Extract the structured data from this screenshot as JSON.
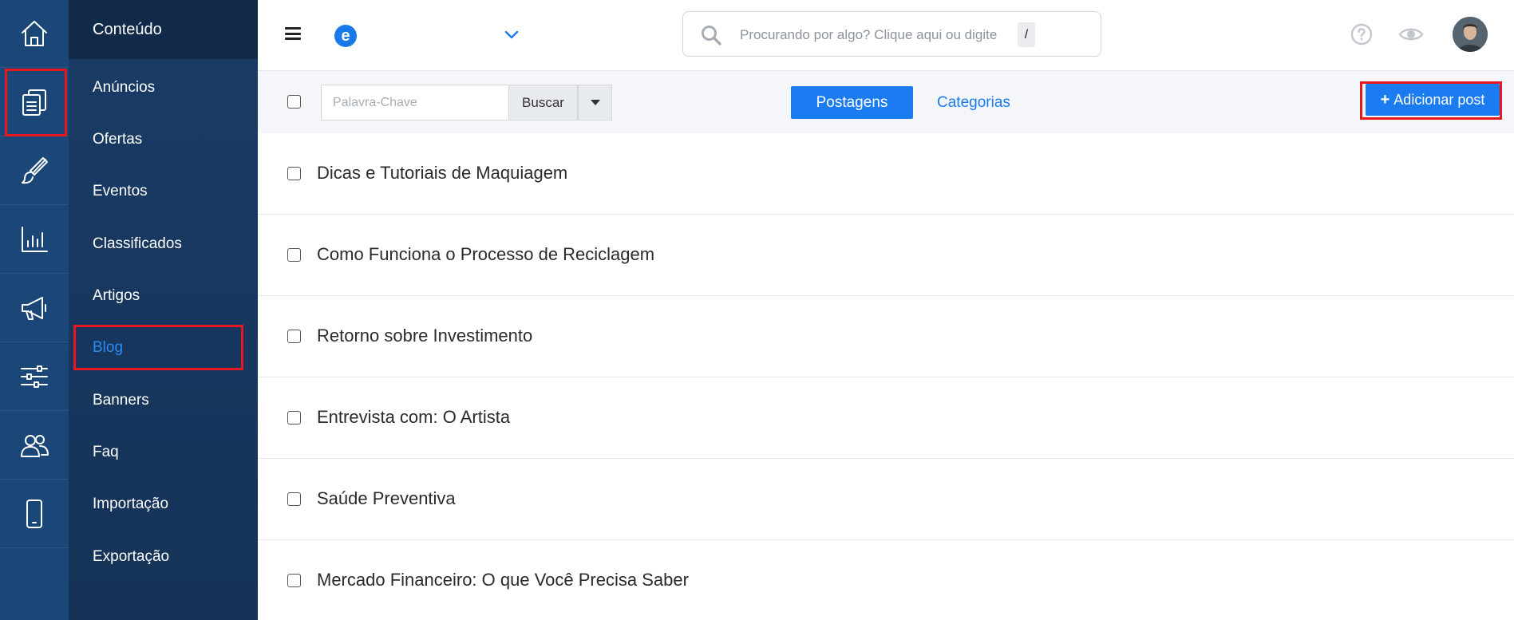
{
  "rail": {
    "items": [
      {
        "icon": "home-icon"
      },
      {
        "icon": "content-icon"
      },
      {
        "icon": "brush-icon"
      },
      {
        "icon": "chart-icon"
      },
      {
        "icon": "megaphone-icon"
      },
      {
        "icon": "sliders-icon"
      },
      {
        "icon": "users-icon"
      },
      {
        "icon": "mobile-icon"
      }
    ]
  },
  "sidebar": {
    "title": "Conteúdo",
    "items": [
      {
        "label": "Anúncios"
      },
      {
        "label": "Ofertas"
      },
      {
        "label": "Eventos"
      },
      {
        "label": "Classificados"
      },
      {
        "label": "Artigos"
      },
      {
        "label": "Blog",
        "active": true
      },
      {
        "label": "Banners"
      },
      {
        "label": "Faq"
      },
      {
        "label": "Importação"
      },
      {
        "label": "Exportação"
      }
    ]
  },
  "topbar": {
    "brand_letter": "e",
    "search": {
      "placeholder": "Procurando por algo? Clique aqui ou digite",
      "shortcut": "/"
    }
  },
  "toolbar": {
    "keyword_placeholder": "Palavra-Chave",
    "search_label": "Buscar",
    "tabs": [
      {
        "label": "Postagens",
        "active": true
      },
      {
        "label": "Categorias",
        "active": false
      }
    ],
    "add_post_label": "Adicionar post"
  },
  "posts": [
    {
      "title": "Dicas e Tutoriais de Maquiagem"
    },
    {
      "title": "Como Funciona o Processo de Reciclagem"
    },
    {
      "title": "Retorno sobre Investimento"
    },
    {
      "title": "Entrevista com: O Artista"
    },
    {
      "title": "Saúde Preventiva"
    },
    {
      "title": "Mercado Financeiro: O que Você Precisa Saber"
    }
  ],
  "colors": {
    "rail": "#1b4678",
    "sidebar": "#193c66",
    "accent": "#1a7cf0",
    "highlight": "#e8161e"
  }
}
